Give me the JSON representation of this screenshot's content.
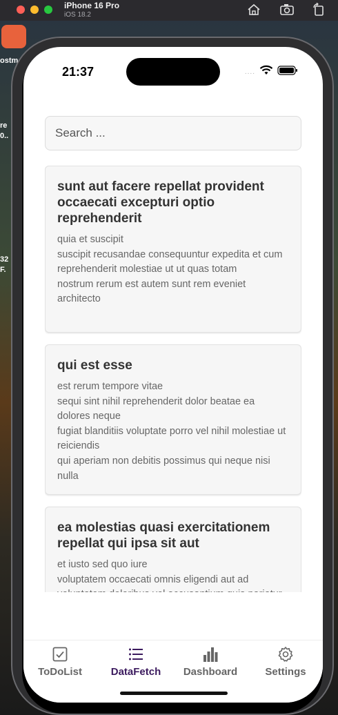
{
  "simulator": {
    "device_name": "iPhone 16 Pro",
    "os_version": "iOS 18.2",
    "icons": [
      "home-icon",
      "screenshot-icon",
      "rotate-icon"
    ]
  },
  "desktop": {
    "labels": [
      "ostm",
      "re",
      "0..",
      "32",
      "F."
    ]
  },
  "status_bar": {
    "time": "21:37",
    "signal_dots": "....",
    "icons": [
      "wifi-icon",
      "battery-icon"
    ]
  },
  "search": {
    "placeholder": "Search ...",
    "value": ""
  },
  "posts": [
    {
      "title": "sunt aut facere repellat provident occaecati excepturi optio reprehenderit",
      "body": "quia et suscipit\nsuscipit recusandae consequuntur expedita et cum\nreprehenderit molestiae ut ut quas totam\nnostrum rerum est autem sunt rem eveniet architecto"
    },
    {
      "title": "qui est esse",
      "body": "est rerum tempore vitae\nsequi sint nihil reprehenderit dolor beatae ea dolores neque\nfugiat blanditiis voluptate porro vel nihil molestiae ut reiciendis\nqui aperiam non debitis possimus qui neque nisi nulla"
    },
    {
      "title": "ea molestias quasi exercitationem repellat qui ipsa sit aut",
      "body": "et iusto sed quo iure\nvoluptatem occaecati omnis eligendi aut ad\nvoluptatem doloribus vel accusantium quis pariatur"
    }
  ],
  "tabs": [
    {
      "label": "ToDoList",
      "icon": "checkbox-icon",
      "active": false
    },
    {
      "label": "DataFetch",
      "icon": "list-icon",
      "active": true
    },
    {
      "label": "Dashboard",
      "icon": "bar-chart-icon",
      "active": false
    },
    {
      "label": "Settings",
      "icon": "gear-icon",
      "active": false
    }
  ],
  "colors": {
    "active_tab": "#3b1a5e",
    "inactive_tab": "#666666"
  }
}
